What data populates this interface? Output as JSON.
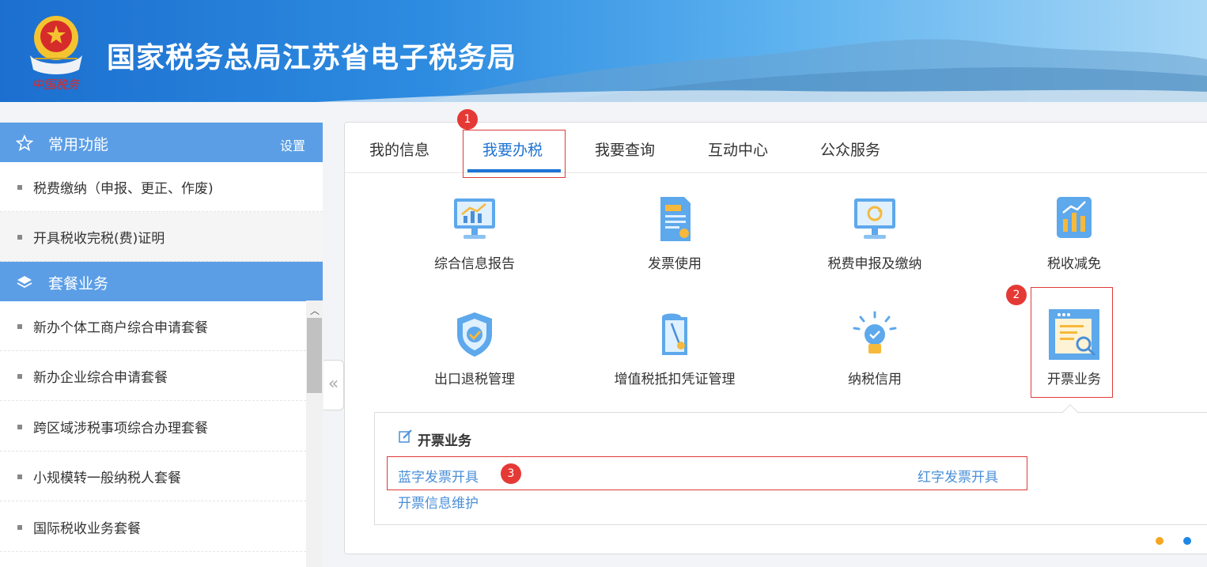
{
  "header": {
    "title": "国家税务总局江苏省电子税务局",
    "emblem_text": "中国税务"
  },
  "sidebar": {
    "common": {
      "title": "常用功能",
      "setting": "设置",
      "items": [
        {
          "label": "税费缴纳（申报、更正、作废)"
        },
        {
          "label": "开具税收完税(费)证明"
        }
      ]
    },
    "packages": {
      "title": "套餐业务",
      "items": [
        {
          "label": "新办个体工商户综合申请套餐"
        },
        {
          "label": "新办企业综合申请套餐"
        },
        {
          "label": "跨区域涉税事项综合办理套餐"
        },
        {
          "label": "小规模转一般纳税人套餐"
        },
        {
          "label": "国际税收业务套餐"
        }
      ]
    }
  },
  "tabs": [
    {
      "label": "我的信息"
    },
    {
      "label": "我要办税"
    },
    {
      "label": "我要查询"
    },
    {
      "label": "互动中心"
    },
    {
      "label": "公众服务"
    }
  ],
  "functions": [
    {
      "label": "综合信息报告",
      "icon": "monitor-chart-icon"
    },
    {
      "label": "发票使用",
      "icon": "invoice-document-icon"
    },
    {
      "label": "税费申报及缴纳",
      "icon": "monitor-refresh-icon"
    },
    {
      "label": "税收减免",
      "icon": "reduction-chart-icon"
    },
    {
      "label": "出口退税管理",
      "icon": "shield-check-icon"
    },
    {
      "label": "增值税抵扣凭证管理",
      "icon": "voucher-icon"
    },
    {
      "label": "纳税信用",
      "icon": "lightbulb-icon"
    },
    {
      "label": "开票业务",
      "icon": "invoicing-window-icon"
    }
  ],
  "subpanel": {
    "title": "开票业务",
    "links": [
      {
        "label": "蓝字发票开具"
      },
      {
        "label": "红字发票开具"
      },
      {
        "label": "开票信息维护"
      }
    ]
  },
  "annotations": {
    "badge1": "1",
    "badge2": "2",
    "badge3": "3"
  },
  "colors": {
    "primary": "#1e73d2",
    "sidebar_header": "#5b9ee6",
    "link": "#4a8fd8",
    "highlight": "#e03a3a"
  }
}
